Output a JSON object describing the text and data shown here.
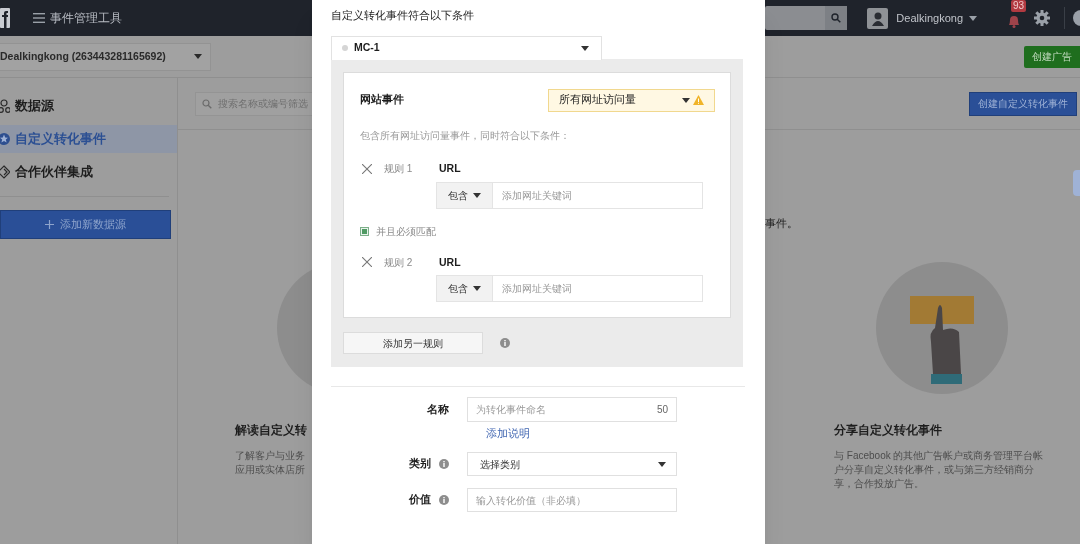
{
  "topbar": {
    "title": "事件管理工具",
    "account_name": "Dealkingkong",
    "notification_count": "93"
  },
  "account_selector": {
    "value": "Dealkingkong (263443281165692)"
  },
  "create_ad_button": "创建广告",
  "sidebar": {
    "items": [
      {
        "label": "数据源",
        "selected": false
      },
      {
        "label": "自定义转化事件",
        "selected": true
      },
      {
        "label": "合作伙伴集成",
        "selected": false
      }
    ],
    "add_button": "添加新数据源"
  },
  "main": {
    "search": {
      "placeholder": "搜索名称或编号筛选"
    },
    "create_button": "创建自定义转化事件",
    "intro_tail": "事件。",
    "cards": [
      {
        "title": "解读自定义转",
        "lines": [
          "了解客户与业务",
          "应用或实体店所"
        ]
      },
      {
        "title": "分享自定义转化事件",
        "lines": [
          "与 Facebook 的其他广告帐户或商务管理平台帐",
          "户分享自定义转化事件，或与第三方经销商分",
          "享，合作投放广告。"
        ]
      }
    ]
  },
  "dialog": {
    "heading": "自定义转化事件符合以下条件",
    "source": "MC-1",
    "event_label": "网站事件",
    "event_value": "所有网址访问量",
    "event_warning": true,
    "hint": "包含所有网址访问量事件，同时符合以下条件：",
    "rules": [
      {
        "label": "规则 1",
        "field": "URL",
        "operator": "包含",
        "placeholder": "添加网址关键词"
      },
      {
        "label": "规则 2",
        "field": "URL",
        "operator": "包含",
        "placeholder": "添加网址关键词"
      }
    ],
    "match_all": {
      "label": "并且必须匹配",
      "checked": true
    },
    "add_rule_button": "添加另一规则",
    "name": {
      "label": "名称",
      "placeholder": "为转化事件命名",
      "counter": "50",
      "link": "添加说明"
    },
    "category": {
      "label": "类别",
      "value": "选择类别"
    },
    "value": {
      "label": "价值",
      "placeholder": "输入转化价值（非必填）"
    }
  }
}
